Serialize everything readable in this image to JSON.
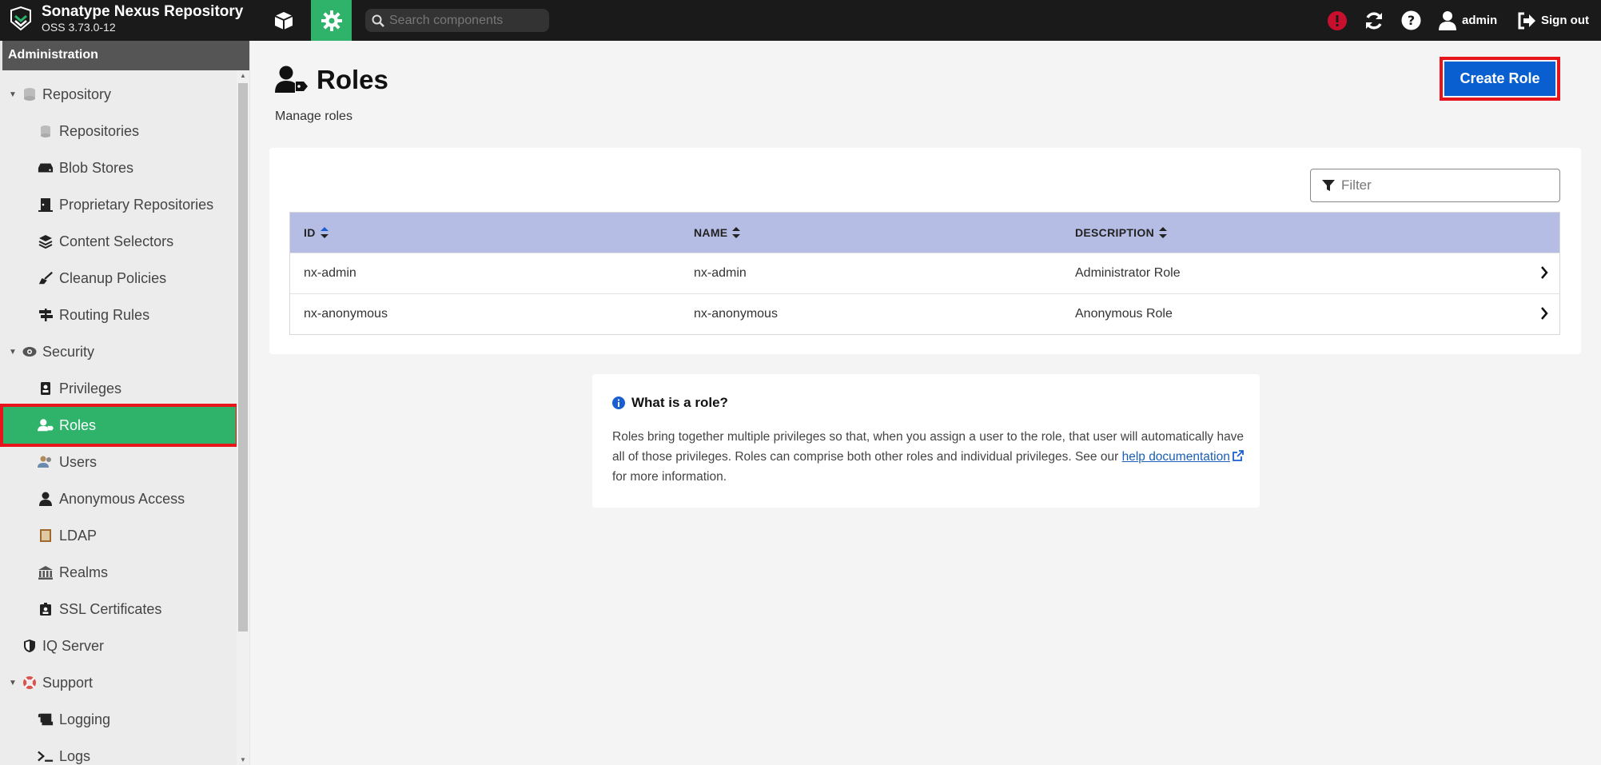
{
  "app": {
    "title": "Sonatype Nexus Repository",
    "version": "OSS 3.73.0-12",
    "brand_color": "#2fb36b"
  },
  "topbar": {
    "search_placeholder": "Search components",
    "user": "admin",
    "signout": "Sign out",
    "icons": [
      "browse-cube-icon",
      "admin-gear-icon",
      "search-icon",
      "alert-icon",
      "refresh-icon",
      "help-icon",
      "user-icon",
      "sign-out-icon"
    ]
  },
  "sidebar": {
    "header": "Administration",
    "items": [
      {
        "label": "Repository",
        "icon": "database-icon",
        "level": 0,
        "expanded": true
      },
      {
        "label": "Repositories",
        "icon": "database-icon",
        "level": 1
      },
      {
        "label": "Blob Stores",
        "icon": "hdd-icon",
        "level": 1
      },
      {
        "label": "Proprietary Repositories",
        "icon": "door-icon",
        "level": 1
      },
      {
        "label": "Content Selectors",
        "icon": "layers-icon",
        "level": 1
      },
      {
        "label": "Cleanup Policies",
        "icon": "broom-icon",
        "level": 1
      },
      {
        "label": "Routing Rules",
        "icon": "signpost-icon",
        "level": 1
      },
      {
        "label": "Security",
        "icon": "eye-icon",
        "level": 0,
        "expanded": true
      },
      {
        "label": "Privileges",
        "icon": "badge-icon",
        "level": 1
      },
      {
        "label": "Roles",
        "icon": "user-tag-icon",
        "level": 1,
        "active": true
      },
      {
        "label": "Users",
        "icon": "users-icon",
        "level": 1
      },
      {
        "label": "Anonymous Access",
        "icon": "user-icon",
        "level": 1
      },
      {
        "label": "LDAP",
        "icon": "book-icon",
        "level": 1
      },
      {
        "label": "Realms",
        "icon": "building-icon",
        "level": 1
      },
      {
        "label": "SSL Certificates",
        "icon": "id-card-icon",
        "level": 1
      },
      {
        "label": "IQ Server",
        "icon": "shield-icon",
        "level": 0
      },
      {
        "label": "Support",
        "icon": "lifebuoy-icon",
        "level": 0,
        "expanded": true
      },
      {
        "label": "Logging",
        "icon": "scroll-icon",
        "level": 1
      },
      {
        "label": "Logs",
        "icon": "terminal-icon",
        "level": 1
      }
    ]
  },
  "main": {
    "title": "Roles",
    "subtitle": "Manage roles",
    "create_button": "Create Role",
    "filter_placeholder": "Filter",
    "columns": [
      "ID",
      "NAME",
      "DESCRIPTION"
    ],
    "rows": [
      {
        "id": "nx-admin",
        "name": "nx-admin",
        "description": "Administrator Role"
      },
      {
        "id": "nx-anonymous",
        "name": "nx-anonymous",
        "description": "Anonymous Role"
      }
    ],
    "info": {
      "title": "What is a role?",
      "text_before": "Roles bring together multiple privileges so that, when you assign a user to the role, that user will automatically have all of those privileges. Roles can comprise both other roles and individual privileges. See our ",
      "link": "help documentation",
      "text_after": " for more information."
    }
  },
  "colors": {
    "topbar": "#1a1a1a",
    "active_green": "#2fb36b",
    "primary_blue": "#0a5fd0",
    "table_header": "#b5bde4",
    "highlight_red": "#e8141b"
  }
}
